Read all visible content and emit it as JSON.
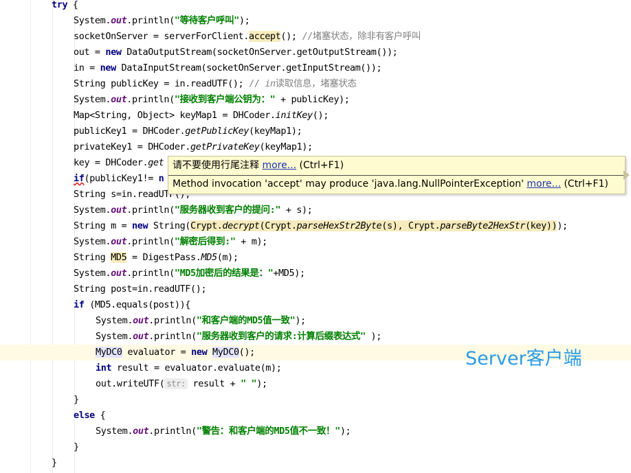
{
  "code": {
    "try_keyword": "try",
    "open_brace": " {",
    "lines": {
      "l1a": "System.",
      "l1b": "out",
      "l1c": ".println(",
      "l1d": "\"等待客户呼叫\"",
      "l1e": ");",
      "l2a": "socketOnServer = serverForClient.",
      "l2b": "accept",
      "l2c": "(); ",
      "l2d": "//堵塞状态，除非有客户呼叫",
      "l3a": "out = ",
      "l3b": "new",
      "l3c": " DataOutputStream(socketOnServer.getOutputStream());",
      "l4a": "in = ",
      "l4b": "new",
      "l4c": " DataInputStream(socketOnServer.getInputStream());",
      "l5a": "String publicKey = in.readUTF(); ",
      "l5b": "// ",
      "l5c": "in",
      "l5d": "读取信息，堵塞状态",
      "l6a": "System.",
      "l6b": "out",
      "l6c": ".println(",
      "l6d": "\"接收到客户端公钥为：\"",
      "l6e": " + publicKey);",
      "l7a": "Map<String, Object> keyMap1 = DHCoder.",
      "l7b": "initKey",
      "l7c": "();",
      "l8a": "publicKey1 = DHCoder.",
      "l8b": "getPublicKey",
      "l8c": "(keyMap1);",
      "l9a": "privateKey1 = DHCoder.",
      "l9b": "getPrivateKey",
      "l9c": "(keyMap1);",
      "l10a": "key = DHCoder.",
      "l10b": "get",
      "l11a": "if",
      "l11b": "(publicKey1!= ",
      "l11c": "n",
      "l12a": "String s=in.readUTF();",
      "l13a": "System.",
      "l13b": "out",
      "l13c": ".println(",
      "l13d": "\"服务器收到客户的提问:\"",
      "l13e": " + s);",
      "l14a": "String m = ",
      "l14b": "new",
      "l14c": " String(",
      "l14d": "Crypt.",
      "l14e": "decrypt",
      "l14f": "(Crypt.",
      "l14g": "parseHexStr2Byte",
      "l14h": "(s), Crypt.",
      "l14i": "parseByte2HexStr",
      "l14j": "(key))",
      "l14k": ");",
      "l15a": "System.",
      "l15b": "out",
      "l15c": ".println(",
      "l15d": "\"解密后得到:\"",
      "l15e": " + m);",
      "l16a": "String ",
      "l16b": "MD5",
      "l16c": " = DigestPass.",
      "l16d": "MD5",
      "l16e": "(m);",
      "l17a": "System.",
      "l17b": "out",
      "l17c": ".println(",
      "l17d": "\"MD5加密后的结果是：\"",
      "l17e": "+MD5);",
      "l18a": "String post=in.readUTF();",
      "l19a": "if",
      "l19b": " (MD5.equals(post)){",
      "l20a": "System.",
      "l20b": "out",
      "l20c": ".println(",
      "l20d": "\"和客户端的MD5值一致\"",
      "l20e": ");",
      "l21a": "System.",
      "l21b": "out",
      "l21c": ".println(",
      "l21d": "\"服务器收到客户的请求:计算后缀表达式\"",
      "l21e": " );",
      "l22a": "MyDC0",
      "l22b": " evaluator = ",
      "l22c": "new",
      "l22d": " ",
      "l22e": "MyDC0",
      "l22f": "();",
      "l23a": "int",
      "l23b": " result = evaluator.evaluate(m);",
      "l24a": "out.writeUTF(",
      "l24hint": "str:",
      "l24b": " result + ",
      "l24c": "\" \"",
      "l24d": ");",
      "l25a": "}",
      "l26a": "else",
      "l26b": " {",
      "l27a": "System.",
      "l27b": "out",
      "l27c": ".println(",
      "l27d": "\"警告：和客户端的MD5值不一致！\"",
      "l27e": ");",
      "l28a": "}",
      "l29a": "}"
    }
  },
  "tooltip": {
    "line1_text": "请不要使用行尾注释 ",
    "line1_link": "more...",
    "line1_shortcut": " (Ctrl+F1)",
    "line2_text": "Method invocation 'accept' may produce 'java.lang.NullPointerException' ",
    "line2_link": "more...",
    "line2_shortcut": " (Ctrl+F1)"
  },
  "watermark": "Server客户端",
  "colors": {
    "keyword": "#000080",
    "string": "#008000",
    "field": "#660e7a",
    "comment": "#808080",
    "tooltip_bg": "#fffbd0",
    "link": "#1a35b3",
    "watermark": "#2c9ce6"
  }
}
